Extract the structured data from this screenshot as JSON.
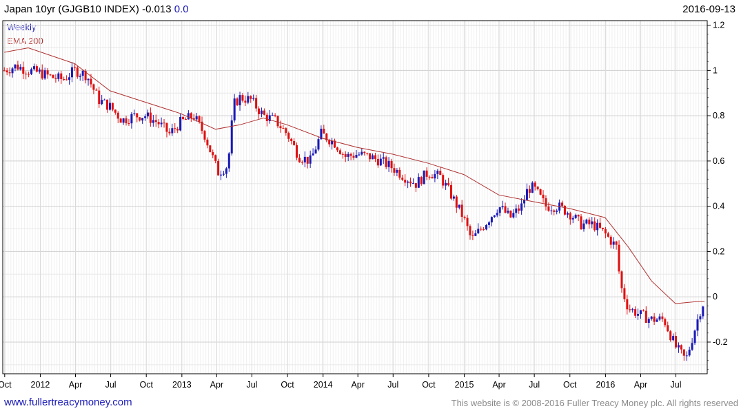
{
  "header": {
    "title": "Japan 10yr (GJGB10 INDEX) -0.013",
    "change": "0.0",
    "date": "2016-09-13"
  },
  "legend": {
    "weekly": "Weekly",
    "ema": "EMA 200"
  },
  "footer": {
    "site": "www.fullertreacymoney.com",
    "rights": "This website is © 2008-2016 Fuller Treacy Money plc. All rights reserved"
  },
  "colors": {
    "up": "#1a1ab8",
    "down": "#e01010",
    "ema": "#b03030",
    "grid": "#d9d9d9"
  },
  "chart_data": {
    "type": "line",
    "title": "",
    "xlabel": "",
    "ylabel": "",
    "x_ticks": [
      "Oct",
      "2012",
      "Apr",
      "Jul",
      "Oct",
      "2013",
      "Apr",
      "Jul",
      "Oct",
      "2014",
      "Apr",
      "Jul",
      "Oct",
      "2015",
      "Apr",
      "Jul",
      "Oct",
      "2016",
      "Apr",
      "Jul"
    ],
    "y_ticks": [
      "1.2",
      "1",
      "0.8",
      "0.6",
      "0.4",
      "0.2",
      "0",
      "-0.2"
    ],
    "ylim": [
      -0.34,
      1.22
    ],
    "xlim": [
      "2011-09-26",
      "2016-09-20"
    ],
    "grid": true,
    "series": [
      {
        "name": "Weekly",
        "x": [
          "2011-09-30",
          "2011-10-31",
          "2011-11-30",
          "2011-12-30",
          "2012-01-31",
          "2012-02-29",
          "2012-03-30",
          "2012-04-30",
          "2012-05-31",
          "2012-06-29",
          "2012-07-31",
          "2012-08-31",
          "2012-09-28",
          "2012-10-31",
          "2012-11-30",
          "2012-12-28",
          "2013-01-31",
          "2013-02-28",
          "2013-03-29",
          "2013-04-05",
          "2013-04-30",
          "2013-05-15",
          "2013-05-31",
          "2013-06-28",
          "2013-07-31",
          "2013-08-30",
          "2013-09-30",
          "2013-10-31",
          "2013-11-29",
          "2013-12-27",
          "2014-01-31",
          "2014-02-28",
          "2014-03-31",
          "2014-04-30",
          "2014-05-30",
          "2014-06-30",
          "2014-07-31",
          "2014-08-29",
          "2014-09-30",
          "2014-10-31",
          "2014-11-28",
          "2014-12-30",
          "2015-01-20",
          "2015-02-27",
          "2015-03-31",
          "2015-04-30",
          "2015-05-29",
          "2015-06-15",
          "2015-06-30",
          "2015-07-31",
          "2015-08-31",
          "2015-09-30",
          "2015-10-30",
          "2015-11-30",
          "2015-12-30",
          "2016-01-29",
          "2016-02-09",
          "2016-02-29",
          "2016-03-31",
          "2016-04-28",
          "2016-05-31",
          "2016-06-30",
          "2016-07-27",
          "2016-08-31",
          "2016-09-13"
        ],
        "values": [
          1.0,
          1.02,
          1.0,
          0.99,
          0.97,
          0.96,
          1.0,
          0.98,
          0.87,
          0.84,
          0.78,
          0.8,
          0.8,
          0.77,
          0.72,
          0.77,
          0.8,
          0.72,
          0.58,
          0.55,
          0.58,
          0.85,
          0.88,
          0.87,
          0.8,
          0.78,
          0.72,
          0.62,
          0.6,
          0.72,
          0.68,
          0.62,
          0.63,
          0.62,
          0.6,
          0.57,
          0.53,
          0.5,
          0.55,
          0.53,
          0.45,
          0.35,
          0.25,
          0.33,
          0.4,
          0.35,
          0.4,
          0.48,
          0.48,
          0.4,
          0.4,
          0.37,
          0.32,
          0.32,
          0.28,
          0.22,
          0.05,
          -0.05,
          -0.08,
          -0.1,
          -0.1,
          -0.22,
          -0.28,
          -0.07,
          -0.013
        ]
      },
      {
        "name": "EMA 200",
        "x": [
          "2011-09-30",
          "2011-12-01",
          "2012-03-30",
          "2012-06-29",
          "2012-09-28",
          "2012-12-28",
          "2013-03-29",
          "2013-05-31",
          "2013-07-31",
          "2013-09-30",
          "2013-12-31",
          "2014-03-31",
          "2014-06-30",
          "2014-09-30",
          "2014-12-31",
          "2015-03-31",
          "2015-06-30",
          "2015-09-30",
          "2015-12-31",
          "2016-02-29",
          "2016-04-29",
          "2016-06-30",
          "2016-08-31",
          "2016-09-13"
        ],
        "values": [
          1.08,
          1.1,
          1.03,
          0.91,
          0.86,
          0.81,
          0.74,
          0.76,
          0.79,
          0.76,
          0.7,
          0.66,
          0.63,
          0.59,
          0.54,
          0.45,
          0.42,
          0.39,
          0.35,
          0.22,
          0.07,
          -0.03,
          -0.02,
          -0.02
        ]
      }
    ]
  }
}
